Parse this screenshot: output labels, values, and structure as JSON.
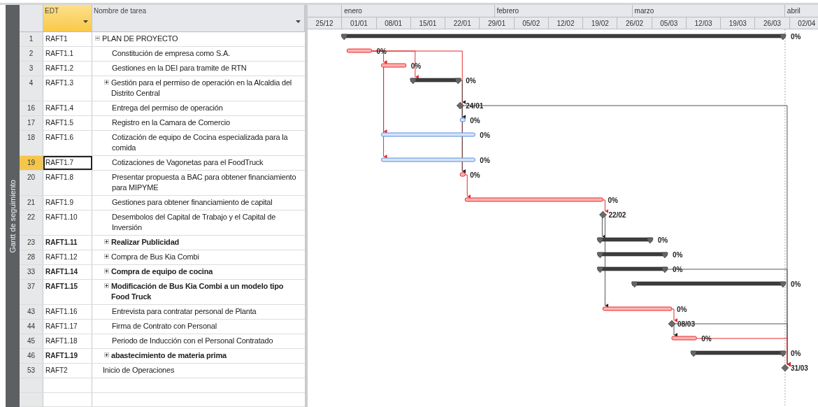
{
  "side_label": "Gantt de seguimiento",
  "columns": [
    {
      "label": "EDT",
      "selected": true
    },
    {
      "label": "Nombre de tarea",
      "selected": false
    }
  ],
  "timescale": {
    "months": [
      "enero",
      "febrero",
      "marzo",
      "abril"
    ],
    "weeks": [
      "25/12",
      "01/01",
      "08/01",
      "15/01",
      "22/01",
      "29/01",
      "05/02",
      "12/02",
      "19/02",
      "26/02",
      "05/03",
      "12/03",
      "19/03",
      "26/03",
      "02/04"
    ]
  },
  "tasks": [
    {
      "id": "1",
      "edt": "RAFT1",
      "name": "PLAN DE PROYECTO",
      "bold": false,
      "selected": false,
      "expanded": true,
      "bar": {
        "kind": "summary",
        "label": "0%"
      },
      "children": [
        {
          "id": "2",
          "edt": "RAFT1.1",
          "name": "Constitución de empresa como S.A.",
          "bold": false,
          "selected": false,
          "bar": {
            "kind": "critical",
            "label": "0%"
          }
        },
        {
          "id": "3",
          "edt": "RAFT1.2",
          "name": "Gestiones en la DEI para tramite de RTN",
          "bold": false,
          "selected": false,
          "bar": {
            "kind": "critical",
            "label": "0%"
          }
        },
        {
          "id": "4",
          "edt": "RAFT1.3",
          "name": "Gestión para el permiso de operación en la Alcaldia del Distrito Central",
          "bold": false,
          "selected": false,
          "expanded": false,
          "bar": {
            "kind": "summary",
            "label": "0%"
          }
        },
        {
          "id": "16",
          "edt": "RAFT1.4",
          "name": "Entrega del permiso de operación",
          "bold": false,
          "selected": false,
          "bar": {
            "kind": "milestone",
            "label": "24/01"
          }
        },
        {
          "id": "17",
          "edt": "RAFT1.5",
          "name": "Registro en la Camara de Comercio",
          "bold": false,
          "selected": false,
          "bar": {
            "kind": "task",
            "label": "0%"
          }
        },
        {
          "id": "18",
          "edt": "RAFT1.6",
          "name": "Cotización de equipo de Cocina especializada para la comida",
          "bold": false,
          "selected": false,
          "bar": {
            "kind": "task",
            "label": "0%"
          }
        },
        {
          "id": "19",
          "edt": "RAFT1.7",
          "name": "Cotizaciones de Vagonetas para el FoodTruck",
          "bold": false,
          "selected": true,
          "bar": {
            "kind": "task",
            "label": "0%"
          }
        },
        {
          "id": "20",
          "edt": "RAFT1.8",
          "name": "Presentar propuesta a BAC para obtener financiamiento para MIPYME",
          "bold": false,
          "selected": false,
          "bar": {
            "kind": "critical",
            "label": "0%"
          }
        },
        {
          "id": "21",
          "edt": "RAFT1.9",
          "name": "Gestiones para obtener financiamiento de capital",
          "bold": false,
          "selected": false,
          "bar": {
            "kind": "critical",
            "label": "0%"
          }
        },
        {
          "id": "22",
          "edt": "RAFT1.10",
          "name": "Desembolos del Capital de Trabajo y el Capital de Inversión",
          "bold": false,
          "selected": false,
          "bar": {
            "kind": "milestone",
            "label": "22/02"
          }
        },
        {
          "id": "23",
          "edt": "RAFT1.11",
          "name": "Realizar Publicidad",
          "bold": true,
          "selected": false,
          "expanded": false,
          "bar": {
            "kind": "summary",
            "label": "0%"
          }
        },
        {
          "id": "28",
          "edt": "RAFT1.12",
          "name": "Compra de Bus Kia Combi",
          "bold": false,
          "selected": false,
          "expanded": false,
          "bar": {
            "kind": "summary",
            "label": "0%"
          }
        },
        {
          "id": "33",
          "edt": "RAFT1.14",
          "name": "Compra de equipo de cocina",
          "bold": true,
          "selected": false,
          "expanded": false,
          "bar": {
            "kind": "summary",
            "label": "0%"
          }
        },
        {
          "id": "37",
          "edt": "RAFT1.15",
          "name": "Modificación de Bus Kia Combi a un modelo tipo Food Truck",
          "bold": true,
          "selected": false,
          "expanded": false,
          "bar": {
            "kind": "summary",
            "label": "0%"
          }
        },
        {
          "id": "43",
          "edt": "RAFT1.16",
          "name": "Entrevista para contratar personal de Planta",
          "bold": false,
          "selected": false,
          "bar": {
            "kind": "critical",
            "label": "0%"
          }
        },
        {
          "id": "44",
          "edt": "RAFT1.17",
          "name": "Firma de Contrato con Personal",
          "bold": false,
          "selected": false,
          "bar": {
            "kind": "milestone",
            "label": "08/03"
          }
        },
        {
          "id": "45",
          "edt": "RAFT1.18",
          "name": "Periodo de Inducción con  el Personal Contratado",
          "bold": false,
          "selected": false,
          "bar": {
            "kind": "critical",
            "label": "0%"
          }
        },
        {
          "id": "46",
          "edt": "RAFT1.19",
          "name": "abastecimiento de materia prima",
          "bold": true,
          "selected": false,
          "expanded": false,
          "bar": {
            "kind": "summary",
            "label": "0%"
          }
        }
      ]
    },
    {
      "id": "53",
      "edt": "RAFT2",
      "name": "Inicio de Operaciones",
      "bold": false,
      "selected": false,
      "bar": {
        "kind": "milestone",
        "label": "31/03"
      }
    }
  ]
}
